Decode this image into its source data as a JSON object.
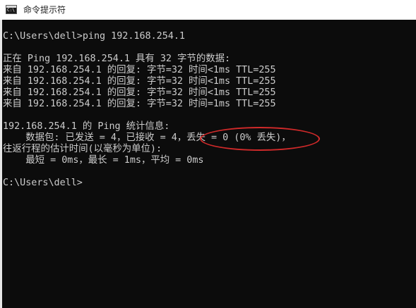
{
  "window": {
    "title": "命令提示符",
    "icon": "terminal-icon",
    "icon_glyph": "C:\\"
  },
  "console": {
    "lines": [
      "C:\\Users\\dell>ping 192.168.254.1",
      "",
      "正在 Ping 192.168.254.1 具有 32 字节的数据:",
      "来自 192.168.254.1 的回复: 字节=32 时间<1ms TTL=255",
      "来自 192.168.254.1 的回复: 字节=32 时间<1ms TTL=255",
      "来自 192.168.254.1 的回复: 字节=32 时间<1ms TTL=255",
      "来自 192.168.254.1 的回复: 字节=32 时间=1ms TTL=255",
      "",
      "192.168.254.1 的 Ping 统计信息:",
      "    数据包: 已发送 = 4，已接收 = 4，丢失 = 0 (0% 丢失)，",
      "往返行程的估计时间(以毫秒为单位):",
      "    最短 = 0ms，最长 = 1ms，平均 = 0ms",
      "",
      "C:\\Users\\dell>"
    ]
  },
  "annotation": {
    "color": "#d12a2a",
    "shape": "ellipse"
  },
  "colors": {
    "console_background": "#0c0c0c",
    "console_text": "#cccccc",
    "titlebar_background": "#ffffff"
  }
}
